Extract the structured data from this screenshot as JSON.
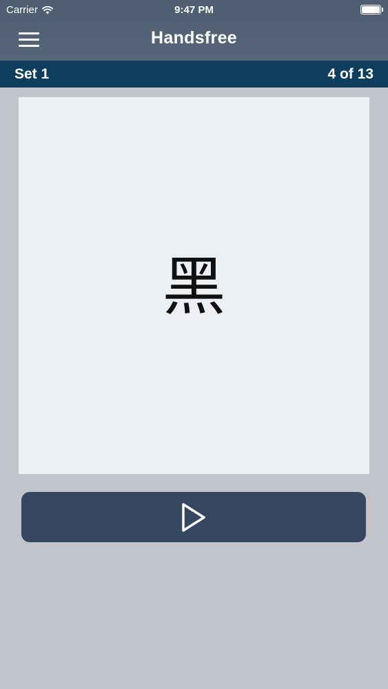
{
  "status_bar": {
    "carrier": "Carrier",
    "time": "9:47 PM",
    "icons": [
      "wifi-icon",
      "battery-icon"
    ]
  },
  "nav": {
    "title": "Handsfree",
    "menu_icon": "hamburger-menu-icon"
  },
  "set_bar": {
    "set_name": "Set 1",
    "progress": "4 of 13"
  },
  "card": {
    "character": "黑"
  },
  "play_button": {
    "icon": "play-icon"
  },
  "colors": {
    "background": "#c1c5cb",
    "header": "#566578",
    "set_bar": "#0f3d5e",
    "card": "#edf0f3",
    "play_button": "#36485f"
  }
}
